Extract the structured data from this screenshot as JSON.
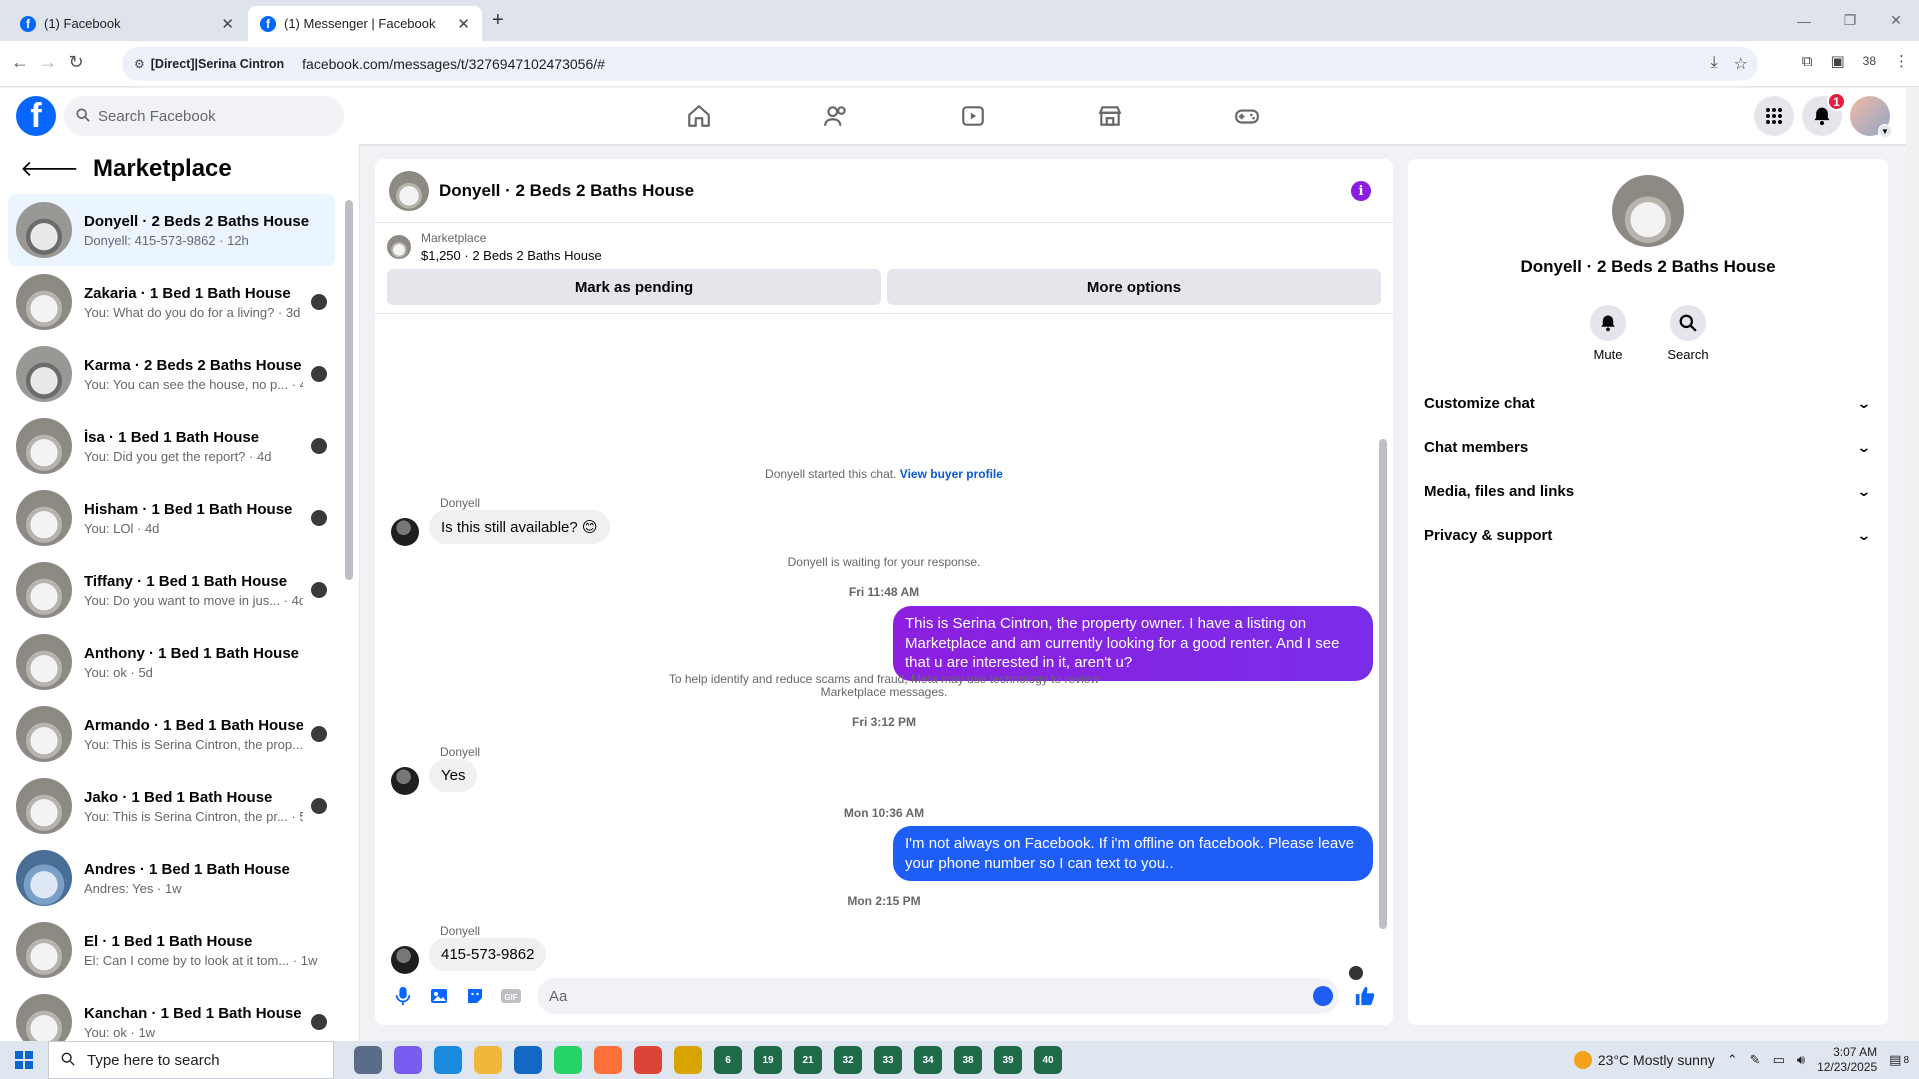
{
  "browser": {
    "tabs": [
      {
        "title": "(1) Facebook",
        "active": false
      },
      {
        "title": "(1) Messenger | Facebook",
        "active": true
      }
    ],
    "site_chip": "[Direct]|Serina Cintron",
    "url": "facebook.com/messages/t/3276947102473056/#",
    "profile_count": "38"
  },
  "fb_header": {
    "search_placeholder": "Search Facebook",
    "notification_count": "1"
  },
  "left_panel": {
    "title": "Marketplace",
    "conversations": [
      {
        "name": "Donyell · 2 Beds 2 Baths House",
        "preview": "Donyell: 415-573-9862 · 12h",
        "selected": true
      },
      {
        "name": "Zakaria · 1 Bed 1 Bath House",
        "preview": "You: What do you do for a living? · 3d"
      },
      {
        "name": "Karma · 2 Beds 2 Baths House",
        "preview": "You: You can see the house, no p... · 4d"
      },
      {
        "name": "İsa · 1 Bed 1 Bath House",
        "preview": "You: Did you get the report? · 4d"
      },
      {
        "name": "Hisham · 1 Bed 1 Bath House",
        "preview": "You: LOl · 4d"
      },
      {
        "name": "Tiffany · 1 Bed 1 Bath House",
        "preview": "You: Do you want to move in jus... · 4d"
      },
      {
        "name": "Anthony · 1 Bed 1 Bath House",
        "preview": "You: ok · 5d"
      },
      {
        "name": "Armando · 1 Bed 1 Bath House",
        "preview": "You: This is Serina Cintron, the prop... · 5d"
      },
      {
        "name": "Jako · 1 Bed 1 Bath House",
        "preview": "You: This is Serina Cintron, the pr... · 5d"
      },
      {
        "name": "Andres · 1 Bed 1 Bath House",
        "preview": "Andres: Yes · 1w"
      },
      {
        "name": "El · 1 Bed 1 Bath House",
        "preview": "El: Can I come by to look at it tom... · 1w"
      },
      {
        "name": "Kanchan · 1 Bed 1 Bath House",
        "preview": "You: ok · 1w"
      }
    ]
  },
  "chat": {
    "title": "Donyell · 2 Beds 2 Baths House",
    "listing_label": "Marketplace",
    "listing_price": "$1,250 · 2 Beds 2 Baths House",
    "btn_pending": "Mark as pending",
    "btn_more": "More options",
    "started_text": "Donyell started this chat.",
    "view_profile": "View buyer profile",
    "sender_name": "Donyell",
    "msg1": "Is this still available? 😊",
    "waiting": "Donyell is waiting for your response.",
    "ts1": "Fri 11:48 AM",
    "out1": "This is Serina Cintron, the property owner. I have a listing on Marketplace and am currently looking for a good renter. And I see that u are interested in it, aren't u?",
    "notice_line1": "To help identify and reduce scams and fraud, Meta may use technology to review",
    "notice_line2": "Marketplace messages.",
    "ts2": "Fri 3:12 PM",
    "msg2": "Yes",
    "ts3": "Mon 10:36 AM",
    "out2": "I'm not always on Facebook. If i'm offline on facebook. Please leave your phone number so I can text to you..",
    "ts4": "Mon 2:15 PM",
    "msg3": "415-573-9862",
    "composer_placeholder": "Aa"
  },
  "info_panel": {
    "name": "Donyell · 2 Beds 2 Baths House",
    "mute": "Mute",
    "search": "Search",
    "sections": [
      "Customize chat",
      "Chat members",
      "Media, files and links",
      "Privacy & support"
    ]
  },
  "taskbar": {
    "search_placeholder": "Type here to search",
    "weather": "23°C  Mostly sunny",
    "time": "3:07 AM",
    "date": "12/23/2025",
    "app_badges": [
      "6",
      "19",
      "21",
      "32",
      "33",
      "34",
      "38",
      "39",
      "40"
    ],
    "notif_count": "8"
  }
}
